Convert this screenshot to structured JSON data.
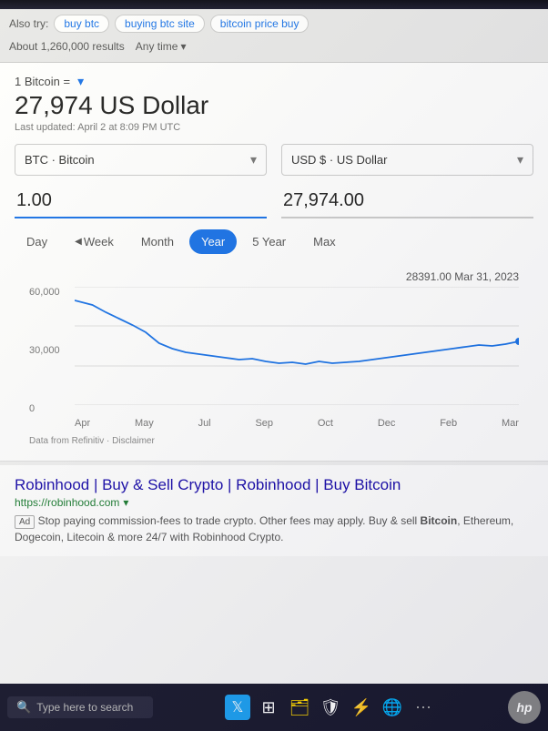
{
  "top": {
    "also_try_label": "Also try:",
    "chips": [
      "buy btc",
      "buying btc site",
      "bitcoin price buy"
    ],
    "results_count": "About 1,260,000 results",
    "time_filter": "Any time"
  },
  "converter": {
    "bitcoin_eq_label": "1 Bitcoin =",
    "price_display": "27,974 US Dollar",
    "last_updated": "Last updated: April 2 at 8:09 PM UTC",
    "from_currency": "BTC · Bitcoin",
    "to_currency": "USD $ · US Dollar",
    "from_amount": "1.00",
    "to_amount": "27,974.00",
    "time_buttons": [
      "Day",
      "Week",
      "Month",
      "Year",
      "5 Year",
      "Max"
    ],
    "active_time": "Year"
  },
  "chart": {
    "tooltip_value": "28391.00 Mar 31, 2023",
    "y_labels": [
      "60,000",
      "30,000",
      "0"
    ],
    "x_labels": [
      "Apr",
      "May",
      "Jul",
      "Sep",
      "Oct",
      "Dec",
      "Feb",
      "Mar"
    ],
    "disclaimer": "Data from Refinitiv · Disclaimer"
  },
  "ad": {
    "title": "Robinhood | Buy & Sell Crypto | Robinhood | Buy Bitcoin",
    "url": "https://robinhood.com",
    "ad_label": "Ad",
    "description": "Stop paying commission-fees to trade crypto. Other fees may apply. Buy & sell Bitcoin, Ethereum, Dogecoin, Litecoin & more 24/7 with Robinhood Crypto."
  },
  "taskbar": {
    "search_placeholder": "Type here to search",
    "hp_label": "hp"
  }
}
